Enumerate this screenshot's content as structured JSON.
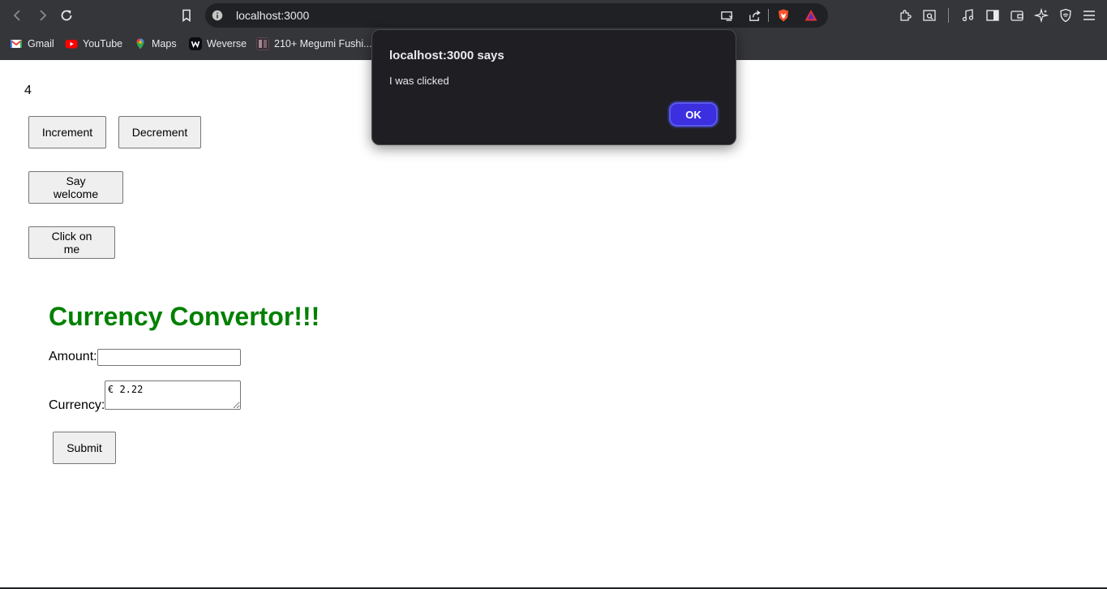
{
  "browser": {
    "url": "localhost:3000",
    "bookmarks": [
      {
        "label": "Gmail",
        "icon": "gmail-icon"
      },
      {
        "label": "YouTube",
        "icon": "youtube-icon"
      },
      {
        "label": "Maps",
        "icon": "maps-icon"
      },
      {
        "label": "Weverse",
        "icon": "weverse-icon"
      },
      {
        "label": "210+ Megumi Fushi...",
        "icon": "bookmark-thumbnail-icon"
      }
    ],
    "toolbar_icons": [
      "back-icon",
      "forward-icon",
      "reload-icon",
      "bookmark-star-icon",
      "info-icon",
      "cast-icon",
      "share-icon",
      "brave-shield-icon",
      "brave-rewards-icon",
      "extensions-icon",
      "search-tab-icon",
      "media-icon",
      "sidebar-icon",
      "wallet-icon",
      "leo-ai-icon",
      "vpn-icon",
      "menu-icon"
    ]
  },
  "page": {
    "counter": "4",
    "increment_label": "Increment",
    "decrement_label": "Decrement",
    "welcome_label": "Say welcome",
    "click_label": "Click on me",
    "heading": "Currency Convertor!!!",
    "amount_label": "Amount:",
    "amount_value": "",
    "currency_label": "Currency:",
    "currency_value": "€ 2.22",
    "submit_label": "Submit",
    "heading_color": "#008000"
  },
  "dialog": {
    "title": "localhost:3000 says",
    "message": "I was clicked",
    "ok_label": "OK",
    "ok_color": "#3b2fe0"
  }
}
